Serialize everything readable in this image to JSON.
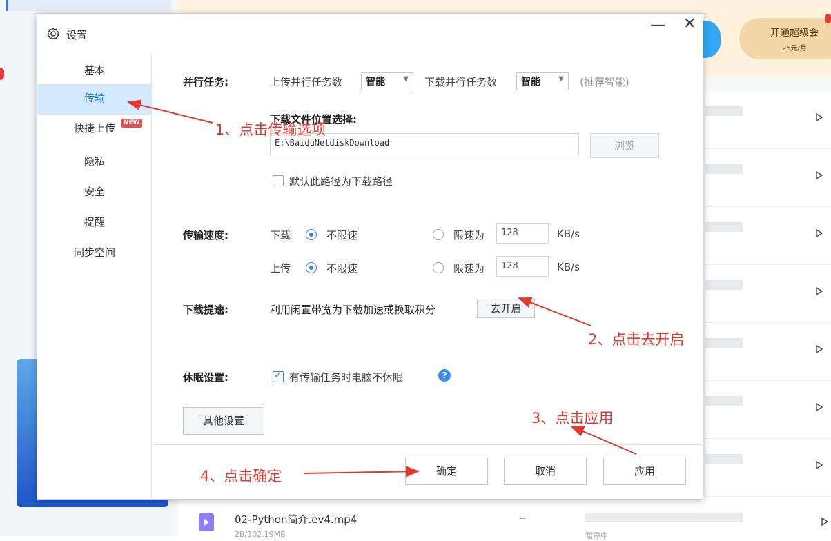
{
  "background": {
    "vip": {
      "line1": "开通超级会",
      "line2": "25元/月"
    },
    "file": {
      "name": "02-Python简介.ev4.mp4",
      "size_dash": "--",
      "sub": "2B/102.19MB",
      "status": "暂停中"
    }
  },
  "dialog": {
    "title": "设置",
    "controls": {
      "minimize": "—",
      "close": "✕"
    },
    "nav": [
      {
        "label": "基本"
      },
      {
        "label": "传输"
      },
      {
        "label": "快捷上传"
      },
      {
        "label": "隐私"
      },
      {
        "label": "安全"
      },
      {
        "label": "提醒"
      },
      {
        "label": "同步空间"
      }
    ],
    "nav_badge": "NEW",
    "parallel": {
      "label": "并行任务:",
      "upload_label": "上传并行任务数",
      "upload_value": "智能",
      "download_label": "下载并行任务数",
      "download_value": "智能",
      "hint": "(推荐智能)"
    },
    "download_path": {
      "label": "下载文件位置选择:",
      "value": "E:\\BaiduNetdiskDownload",
      "browse": "浏览",
      "default_label": "默认此路径为下载路径"
    },
    "speed": {
      "label": "传输速度:",
      "download_label": "下载",
      "upload_label": "上传",
      "unlimited": "不限速",
      "limit_to": "限速为",
      "download_limit_value": "128",
      "upload_limit_value": "128",
      "unit": "KB/s"
    },
    "boost": {
      "label": "下载提速:",
      "desc": "利用闲置带宽为下载加速或换取积分",
      "button": "去开启"
    },
    "sleep": {
      "label": "休眠设置:",
      "option": "有传输任务时电脑不休眠",
      "help": "?"
    },
    "other_settings": "其他设置",
    "footer": {
      "ok": "确定",
      "cancel": "取消",
      "apply": "应用"
    }
  },
  "annotations": {
    "step1": "1、点击传输选项",
    "step2": "2、点击去开启",
    "step3": "3、点击应用",
    "step4": "4、点击确定"
  },
  "colors": {
    "accent": "#2a84e8",
    "annotation": "#e23a2f",
    "active_nav_bg": "#d4ebff"
  }
}
